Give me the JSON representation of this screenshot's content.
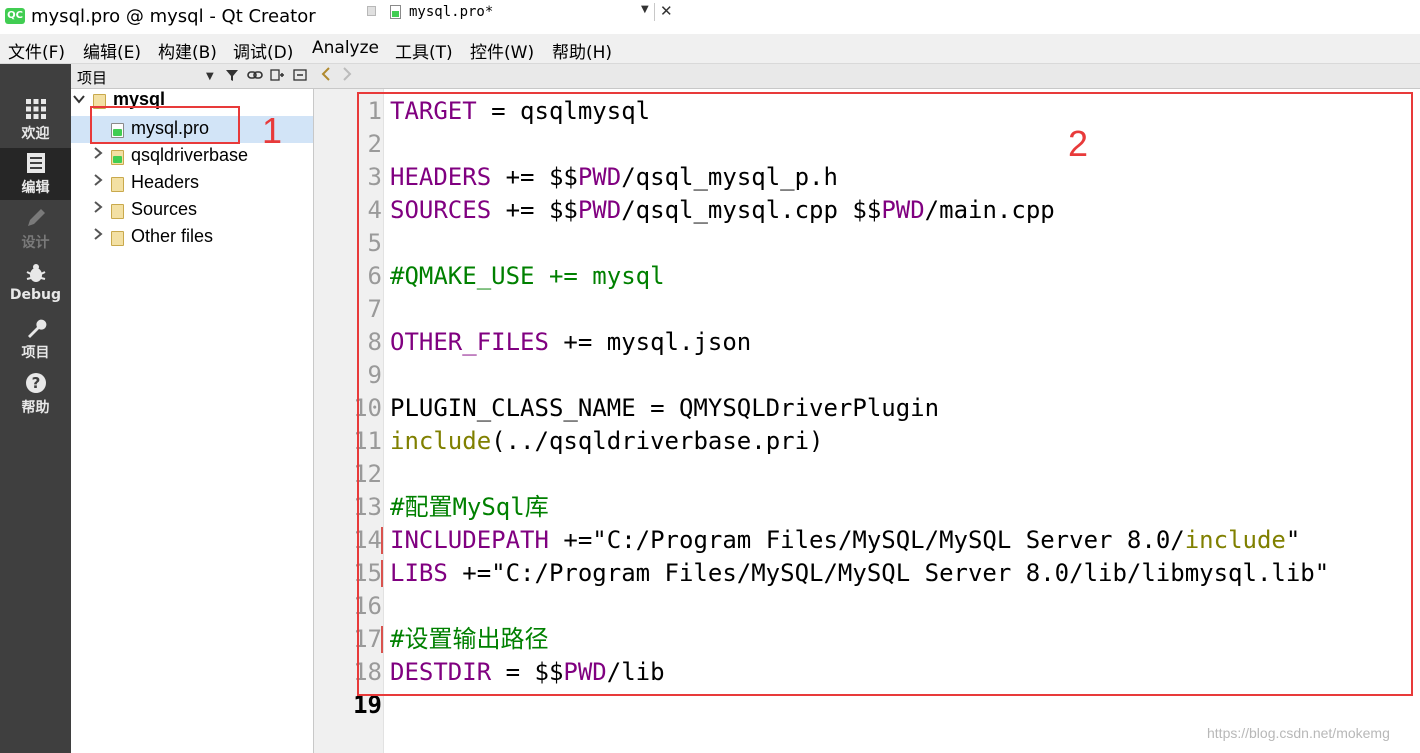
{
  "window": {
    "title": "mysql.pro @ mysql - Qt Creator",
    "app_logo": "QC"
  },
  "menubar": [
    "文件(F)",
    "编辑(E)",
    "构建(B)",
    "调试(D)",
    "Analyze",
    "工具(T)",
    "控件(W)",
    "帮助(H)"
  ],
  "modes": [
    {
      "label": "欢迎",
      "icon": "grid-icon"
    },
    {
      "label": "编辑",
      "icon": "document-icon",
      "active": true
    },
    {
      "label": "设计",
      "icon": "pencil-icon",
      "disabled": true
    },
    {
      "label": "Debug",
      "icon": "bug-icon"
    },
    {
      "label": "项目",
      "icon": "wrench-icon"
    },
    {
      "label": "帮助",
      "icon": "help-icon"
    }
  ],
  "project_panel": {
    "header": "项目",
    "tree": [
      {
        "label": "mysql",
        "expanded": true,
        "bold": true
      },
      {
        "label": "mysql.pro",
        "selected": true
      },
      {
        "label": "qsqldriverbase",
        "collapsed": true
      },
      {
        "label": "Headers",
        "collapsed": true
      },
      {
        "label": "Sources",
        "collapsed": true
      },
      {
        "label": "Other files",
        "collapsed": true
      }
    ]
  },
  "editor": {
    "tab_title": "mysql.pro*",
    "lines": [
      {
        "n": "1",
        "segs": [
          {
            "t": "TARGET",
            "c": "#800080"
          },
          {
            "t": " = qsqlmysql",
            "c": "#000000"
          }
        ]
      },
      {
        "n": "2",
        "segs": []
      },
      {
        "n": "3",
        "segs": [
          {
            "t": "HEADERS",
            "c": "#800080"
          },
          {
            "t": " += $$",
            "c": "#000000"
          },
          {
            "t": "PWD",
            "c": "#800080"
          },
          {
            "t": "/qsql_mysql_p.h",
            "c": "#000000"
          }
        ]
      },
      {
        "n": "4",
        "segs": [
          {
            "t": "SOURCES",
            "c": "#800080"
          },
          {
            "t": " += $$",
            "c": "#000000"
          },
          {
            "t": "PWD",
            "c": "#800080"
          },
          {
            "t": "/qsql_mysql.cpp $$",
            "c": "#000000"
          },
          {
            "t": "PWD",
            "c": "#800080"
          },
          {
            "t": "/main.cpp",
            "c": "#000000"
          }
        ]
      },
      {
        "n": "5",
        "segs": []
      },
      {
        "n": "6",
        "segs": [
          {
            "t": "#QMAKE_USE += mysql",
            "c": "#008000"
          }
        ]
      },
      {
        "n": "7",
        "segs": []
      },
      {
        "n": "8",
        "segs": [
          {
            "t": "OTHER_FILES",
            "c": "#800080"
          },
          {
            "t": " += mysql.json",
            "c": "#000000"
          }
        ]
      },
      {
        "n": "9",
        "segs": []
      },
      {
        "n": "10",
        "segs": [
          {
            "t": "PLUGIN_CLASS_NAME = QMYSQLDriverPlugin",
            "c": "#000000"
          }
        ]
      },
      {
        "n": "11",
        "segs": [
          {
            "t": "include",
            "c": "#808000"
          },
          {
            "t": "(../qsqldriverbase.pri)",
            "c": "#000000"
          }
        ]
      },
      {
        "n": "12",
        "segs": []
      },
      {
        "n": "13",
        "segs": [
          {
            "t": "#配置MySql库",
            "c": "#008000"
          }
        ]
      },
      {
        "n": "14",
        "segs": [
          {
            "t": "INCLUDEPATH",
            "c": "#800080"
          },
          {
            "t": " +=\"C:/Program Files/MySQL/MySQL Server 8.0/",
            "c": "#000000"
          },
          {
            "t": "include",
            "c": "#808000"
          },
          {
            "t": "\"",
            "c": "#000000"
          }
        ],
        "marked": true
      },
      {
        "n": "15",
        "segs": [
          {
            "t": "LIBS",
            "c": "#800080"
          },
          {
            "t": " +=\"C:/Program Files/MySQL/MySQL Server 8.0/lib/libmysql.lib\"",
            "c": "#000000"
          }
        ],
        "marked": true
      },
      {
        "n": "16",
        "segs": []
      },
      {
        "n": "17",
        "segs": [
          {
            "t": "#设置输出路径",
            "c": "#008000"
          }
        ],
        "marked": true
      },
      {
        "n": "18",
        "segs": [
          {
            "t": "DESTDIR",
            "c": "#800080"
          },
          {
            "t": " = $$",
            "c": "#000000"
          },
          {
            "t": "PWD",
            "c": "#800080"
          },
          {
            "t": "/lib",
            "c": "#000000"
          }
        ]
      },
      {
        "n": "19",
        "segs": [],
        "current": true
      }
    ]
  },
  "annotations": {
    "box1": "1",
    "box2": "2",
    "color": "#e83a3a"
  },
  "watermark": "https://blog.csdn.net/mokemg"
}
